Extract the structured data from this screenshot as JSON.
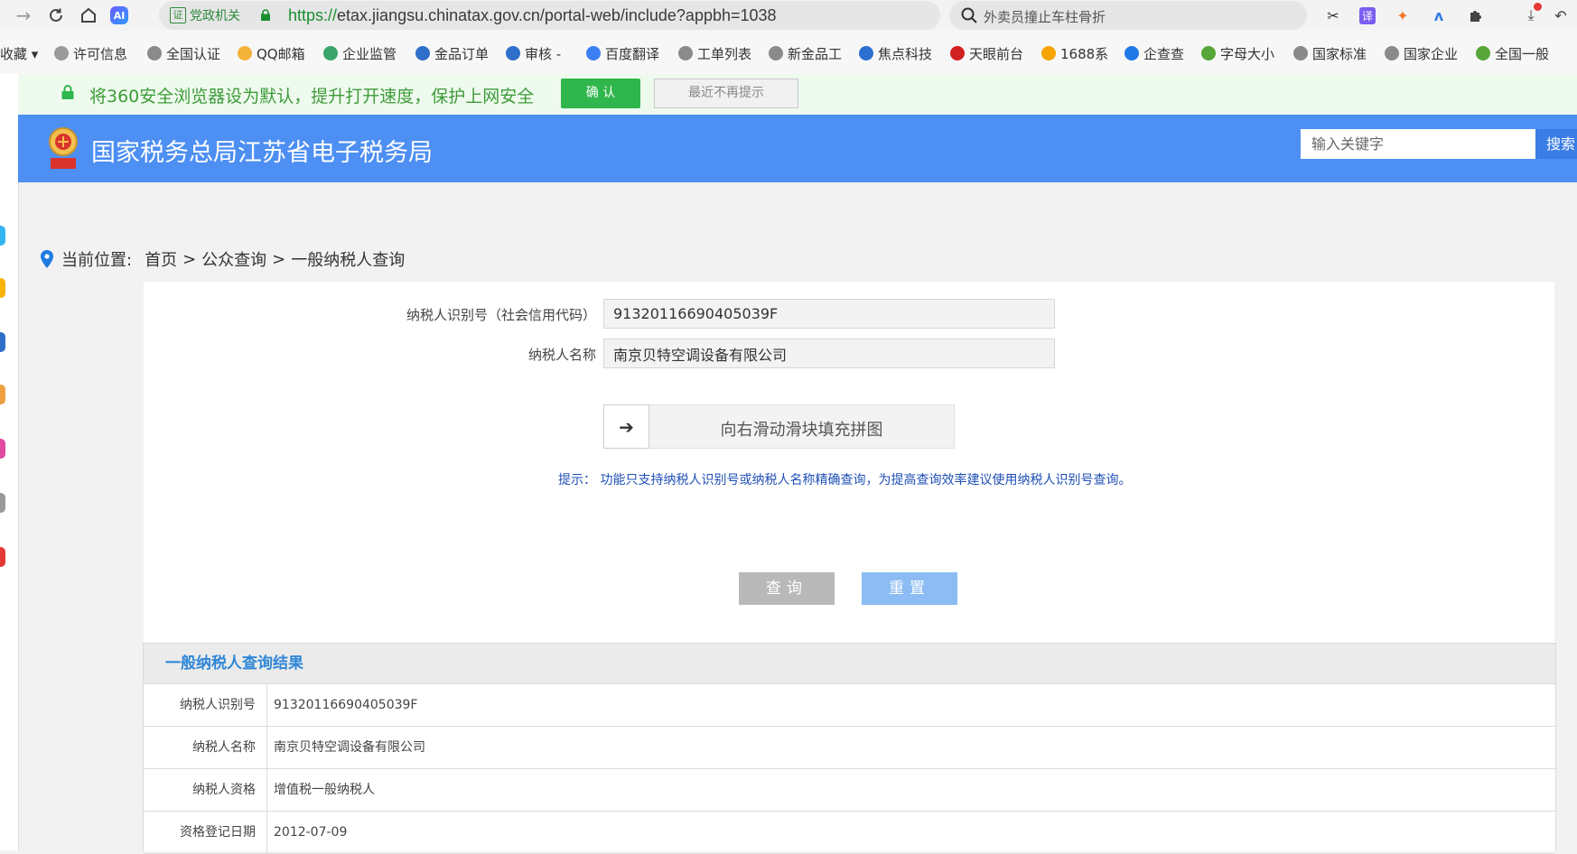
{
  "browser": {
    "site_tag": "党政机关",
    "url_scheme": "https://",
    "url_rest": "etax.jiangsu.chinatax.gov.cn/portal-web/include?appbh=1038",
    "search_text": "外卖员撞止车柱骨折",
    "ai_label": "AI",
    "translate_label": "译"
  },
  "bookmarks": [
    {
      "label": "收藏 ▾",
      "color": "transparent"
    },
    {
      "label": "许可信息",
      "color": "#9a9a9a"
    },
    {
      "label": "全国认证",
      "color": "#8a8a8a"
    },
    {
      "label": "QQ邮箱",
      "color": "#f3b23a"
    },
    {
      "label": "企业监管",
      "color": "#3aa56b"
    },
    {
      "label": "金品订单",
      "color": "#2f6ec9"
    },
    {
      "label": "审核 -",
      "color": "#2f6ec9"
    },
    {
      "label": "百度翻译",
      "color": "#3b7ff2"
    },
    {
      "label": "工单列表",
      "color": "#8a8a8a"
    },
    {
      "label": "新金品工",
      "color": "#8a8a8a"
    },
    {
      "label": "焦点科技",
      "color": "#2b6fd1"
    },
    {
      "label": "天眼前台",
      "color": "#d32020"
    },
    {
      "label": "1688系",
      "color": "#f5a400"
    },
    {
      "label": "企查查",
      "color": "#1f7ae6"
    },
    {
      "label": "字母大小",
      "color": "#57a639"
    },
    {
      "label": "国家标准",
      "color": "#8a8a8a"
    },
    {
      "label": "国家企业",
      "color": "#8a8a8a"
    },
    {
      "label": "全国一般",
      "color": "#57a639"
    }
  ],
  "notice": {
    "text": "将360安全浏览器设为默认，提升打开速度，保护上网安全",
    "confirm_label": "确 认",
    "dismiss_label": "最近不再提示"
  },
  "header": {
    "title": "国家税务总局江苏省电子税务局",
    "search_placeholder": "输入关键字",
    "search_button": "搜索"
  },
  "breadcrumb": {
    "prefix": "当前位置:",
    "items": [
      "首页",
      "公众查询",
      "一般纳税人查询"
    ],
    "separator": ">"
  },
  "form": {
    "id_label": "纳税人识别号（社会信用代码）",
    "id_value": "91320116690405039F",
    "name_label": "纳税人名称",
    "name_value": "南京贝特空调设备有限公司",
    "slider_text": "向右滑动滑块填充拼图",
    "tip": "提示：  功能只支持纳税人识别号或纳税人名称精确查询，为提高查询效率建议使用纳税人识别号查询。",
    "query_button": "查询",
    "reset_button": "重置"
  },
  "results": {
    "title": "一般纳税人查询结果",
    "rows": [
      {
        "key": "纳税人识别号",
        "value": "91320116690405039F"
      },
      {
        "key": "纳税人名称",
        "value": "南京贝特空调设备有限公司"
      },
      {
        "key": "纳税人资格",
        "value": "增值税一般纳税人"
      },
      {
        "key": "资格登记日期",
        "value": "2012-07-09"
      }
    ]
  },
  "colors": {
    "header_blue": "#4d8ff2",
    "notice_green": "#3d9b39",
    "confirm_green": "#2fb64c",
    "reset_blue": "#8cbcf3",
    "result_title_blue": "#2f87d7",
    "tip_blue": "#1f4fb5"
  }
}
